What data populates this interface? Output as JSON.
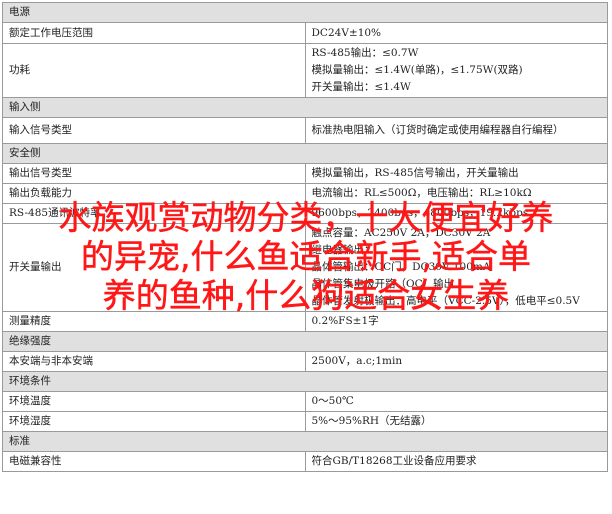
{
  "rows": [
    {
      "kind": "section",
      "label": "电源"
    },
    {
      "kind": "row",
      "label": "额定工作电压范围",
      "values": [
        "DC24V±10%"
      ]
    },
    {
      "kind": "row",
      "label": "功耗",
      "values": [
        "RS-485输出：≤0.7W",
        "模拟量输出：≤1.4W(单路)，≤1.75W(双路)",
        "开关量输出：≤1.4W"
      ]
    },
    {
      "kind": "section",
      "label": "输入侧"
    },
    {
      "kind": "row",
      "label": "输入信号类型",
      "values": [
        "标准热电阻输入（订货时确定或使用编程器自行编程）"
      ]
    },
    {
      "kind": "section",
      "label": "安全侧"
    },
    {
      "kind": "row",
      "label": "输出信号类型",
      "values": [
        "模拟量输出，RS-485信号输出，开关量输出"
      ]
    },
    {
      "kind": "row",
      "label": "输出负载能力",
      "values": [
        "电流输出：RL≤500Ω，电压输出：RL≥10kΩ"
      ]
    },
    {
      "kind": "row",
      "label": "RS-485通讯波特率",
      "values": [
        "9600bps，2400bps，4800bps，19.2kbps"
      ]
    },
    {
      "kind": "row",
      "label": "开关量输出",
      "values": [
        "触点容量：AC250V 2A，DC30V 2A",
        "继电器输出：",
        "晶体管输出：OC门，DC30V 100mA",
        "晶体管集电极开路（OC）输出",
        "晶体管发射极输出：高电平（VCC-2.5V），低电平≤0.5V"
      ]
    },
    {
      "kind": "row",
      "label": "测量精度",
      "values": [
        "0.2%FS±1字"
      ]
    },
    {
      "kind": "section",
      "label": "绝缘强度"
    },
    {
      "kind": "row",
      "label": "本安端与非本安端",
      "values": [
        "2500V，a.c;1min"
      ]
    },
    {
      "kind": "section",
      "label": "环境条件"
    },
    {
      "kind": "row",
      "label": "环境温度",
      "values": [
        "0～50℃"
      ]
    },
    {
      "kind": "row",
      "label": "环境湿度",
      "values": [
        "5%～95%RH（无结露）"
      ]
    },
    {
      "kind": "section",
      "label": "标准"
    },
    {
      "kind": "row",
      "label": "电磁兼容性",
      "values": [
        "符合GB/T18268工业设备应用要求"
      ]
    }
  ],
  "overlay": {
    "lines": [
      "水族观赏动物分类，十大便宜好养",
      "的异宠,什么鱼适合新手,适合单",
      "养的鱼种,什么狗适合女生养"
    ],
    "color": "#ff1717"
  }
}
